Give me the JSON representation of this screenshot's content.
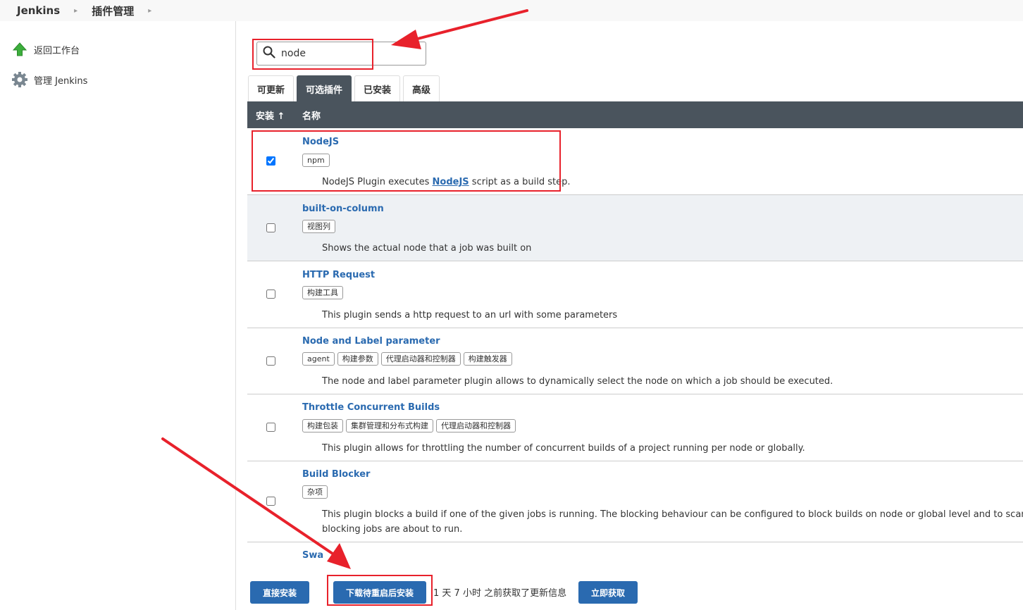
{
  "breadcrumb": {
    "items": [
      "Jenkins",
      "插件管理"
    ]
  },
  "sidebar": {
    "items": [
      {
        "label": "返回工作台",
        "icon": "up-arrow-icon"
      },
      {
        "label": "管理 Jenkins",
        "icon": "gear-icon"
      }
    ]
  },
  "search": {
    "value": "node",
    "icon": "search-icon"
  },
  "tabs": [
    {
      "label": "可更新",
      "active": false
    },
    {
      "label": "可选插件",
      "active": true
    },
    {
      "label": "已安装",
      "active": false
    },
    {
      "label": "高级",
      "active": false
    }
  ],
  "table": {
    "headers": {
      "install": "安装 ↑",
      "name": "名称"
    },
    "rows": [
      {
        "name": "NodeJS",
        "checked": true,
        "tags": [
          "npm"
        ],
        "desc_prefix": "NodeJS Plugin executes ",
        "desc_link": "NodeJS",
        "desc_suffix": " script as a build step."
      },
      {
        "name": "built-on-column",
        "checked": false,
        "tags": [
          "视图列"
        ],
        "desc": "Shows the actual node that a job was built on"
      },
      {
        "name": "HTTP Request",
        "checked": false,
        "tags": [
          "构建工具"
        ],
        "desc": "This plugin sends a http request to an url with some parameters"
      },
      {
        "name": "Node and Label parameter",
        "checked": false,
        "tags": [
          "agent",
          "构建参数",
          "代理启动器和控制器",
          "构建触发器"
        ],
        "desc": "The node and label parameter plugin allows to dynamically select the node on which a job should be executed."
      },
      {
        "name": "Throttle Concurrent Builds",
        "checked": false,
        "tags": [
          "构建包装",
          "集群管理和分布式构建",
          "代理启动器和控制器"
        ],
        "desc": "This plugin allows for throttling the number of concurrent builds of a project running per node or globally."
      },
      {
        "name": "Build Blocker",
        "checked": false,
        "tags": [
          "杂项"
        ],
        "desc_line1": "This plugin blocks a build if one of the given jobs is running. The blocking behaviour can be configured to block builds on node or global level and to scan the qu",
        "desc_line2": "blocking jobs are about to run."
      },
      {
        "name": "Swa"
      }
    ]
  },
  "bottom": {
    "install_now": "直接安装",
    "download_restart": "下载待重启后安装",
    "status": "1 天 7 小时 之前获取了更新信息",
    "fetch_now": "立即获取"
  },
  "colors": {
    "accent": "#2a6ab0",
    "header_bg": "#4a545d",
    "annotation": "#e8212b"
  }
}
